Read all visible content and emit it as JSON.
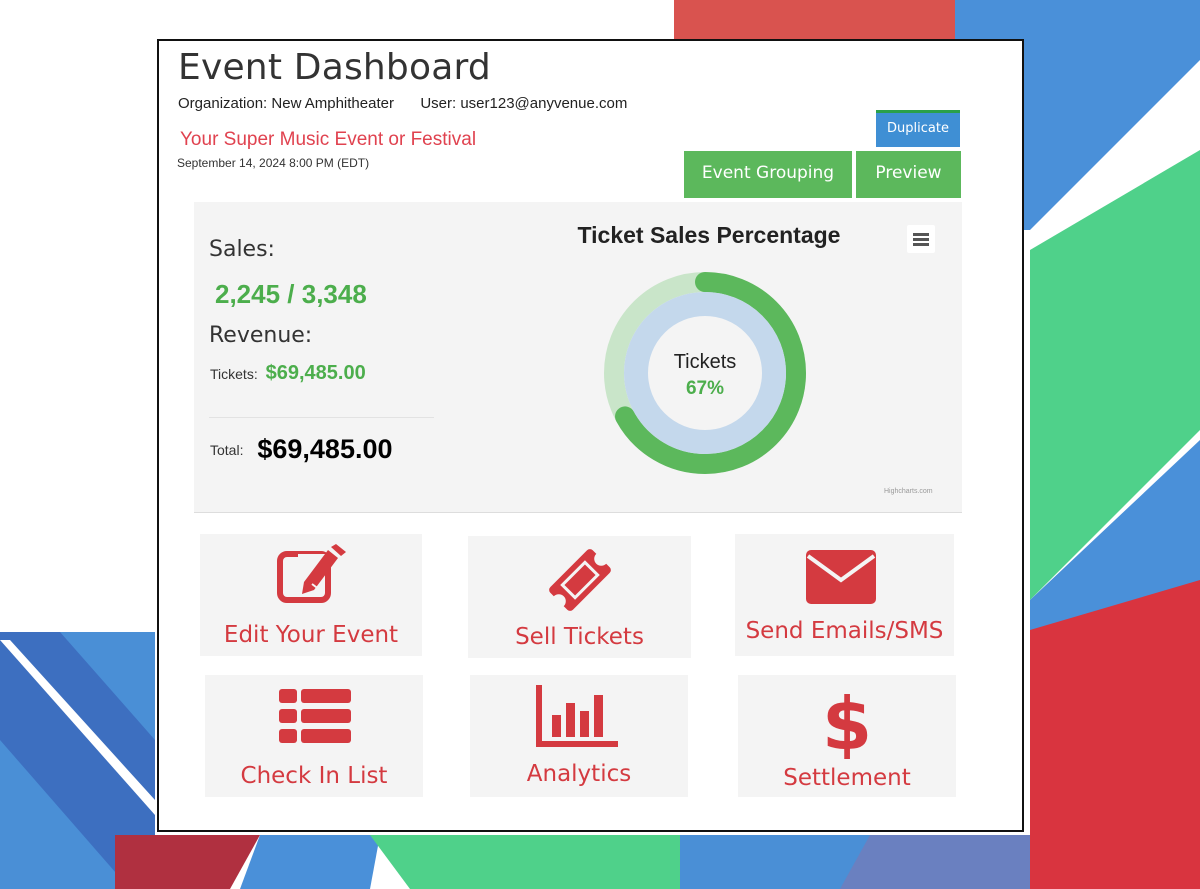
{
  "header": {
    "title": "Event Dashboard",
    "organization_label": "Organization:",
    "organization_value": "New Amphitheater",
    "user_label": "User:",
    "user_value": "user123@anyvenue.com",
    "event_name": "Your Super Music Event or Festival",
    "event_datetime": "September 14, 2024 8:00 PM (EDT)"
  },
  "actions": {
    "duplicate": "Duplicate",
    "event_grouping": "Event Grouping",
    "preview": "Preview"
  },
  "stats": {
    "sales_label": "Sales:",
    "sales_value": "2,245 / 3,348",
    "revenue_label": "Revenue:",
    "tickets_label": "Tickets:",
    "tickets_value": "$69,485.00",
    "total_label": "Total:",
    "total_value": "$69,485.00"
  },
  "chart_data": {
    "type": "pie",
    "title": "Ticket Sales Percentage",
    "center_label": "Tickets",
    "center_value": "67%",
    "sold": 2245,
    "capacity": 3348,
    "sold_percent": 67,
    "colors": {
      "sold": "#5cb85c",
      "remaining": "#c9e5c9",
      "inner": "#c4d8ec",
      "center": "#f4f4f4"
    },
    "credit": "Highcharts.com"
  },
  "tiles": [
    {
      "label": "Edit Your Event",
      "icon": "edit-icon"
    },
    {
      "label": "Sell Tickets",
      "icon": "ticket-icon"
    },
    {
      "label": "Send Emails/SMS",
      "icon": "envelope-icon"
    },
    {
      "label": "Check In List",
      "icon": "list-icon"
    },
    {
      "label": "Analytics",
      "icon": "bar-chart-icon"
    },
    {
      "label": "Settlement",
      "icon": "dollar-icon"
    }
  ],
  "theme": {
    "accent_red": "#d43a40",
    "green": "#5cb85c",
    "blue": "#3f8fd4"
  }
}
